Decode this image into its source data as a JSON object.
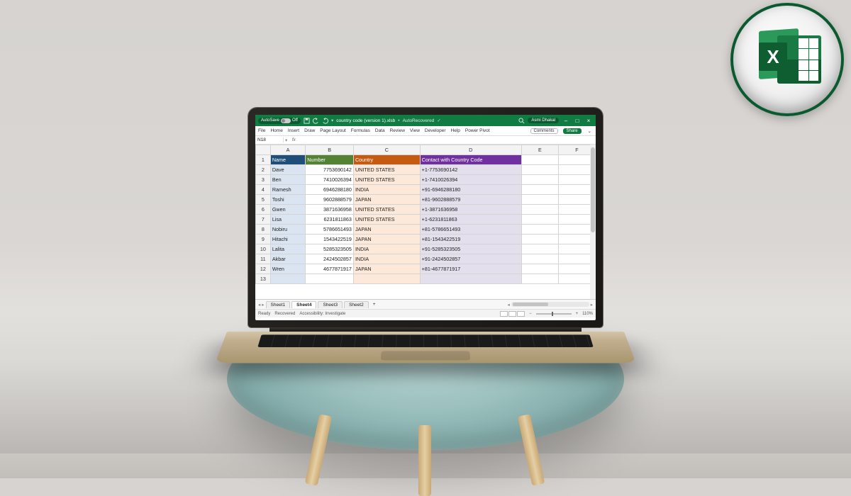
{
  "titlebar": {
    "autosave_label": "AutoSave",
    "autosave_state": "Off",
    "filename": "country code (version 1).xlsb",
    "recovered": "AutoRecovered",
    "search_placeholder": "Search",
    "user": "Asmi Dhakal",
    "minimize": "–",
    "maximize": "□",
    "close": "×"
  },
  "ribbon": {
    "tabs": [
      "File",
      "Home",
      "Insert",
      "Draw",
      "Page Layout",
      "Formulas",
      "Data",
      "Review",
      "View",
      "Developer",
      "Help",
      "Power Pivot"
    ],
    "comments": "Comments",
    "share": "Share"
  },
  "namebox": {
    "cell": "N18",
    "fx": "fx",
    "formula": ""
  },
  "columns": [
    "",
    "A",
    "B",
    "C",
    "D",
    "E",
    "F"
  ],
  "headers": {
    "a": "Name",
    "b": "Number",
    "c": "Country",
    "d": "Contact with Country Code"
  },
  "rows": [
    {
      "n": "1"
    },
    {
      "n": "2",
      "a": "Dave",
      "b": "7753690142",
      "c": "UNITED STATES",
      "d": "+1-7753690142"
    },
    {
      "n": "3",
      "a": "Ben",
      "b": "7410026394",
      "c": "UNITED STATES",
      "d": "+1-7410026394"
    },
    {
      "n": "4",
      "a": "Ramesh",
      "b": "6946288180",
      "c": "INDIA",
      "d": "+91-6946288180"
    },
    {
      "n": "5",
      "a": "Toshi",
      "b": "9602888579",
      "c": "JAPAN",
      "d": "+81-9602888579"
    },
    {
      "n": "6",
      "a": "Gwen",
      "b": "3871636958",
      "c": "UNITED STATES",
      "d": "+1-3871636958"
    },
    {
      "n": "7",
      "a": "Lisa",
      "b": "6231811863",
      "c": "UNITED STATES",
      "d": "+1-6231811863"
    },
    {
      "n": "8",
      "a": "Nobiru",
      "b": "5786651493",
      "c": "JAPAN",
      "d": "+81-5786651493"
    },
    {
      "n": "9",
      "a": "Hitachi",
      "b": "1543422519",
      "c": "JAPAN",
      "d": "+81-1543422519"
    },
    {
      "n": "10",
      "a": "Lalita",
      "b": "5285323505",
      "c": "INDIA",
      "d": "+91-5285323505"
    },
    {
      "n": "11",
      "a": "Akbar",
      "b": "2424502857",
      "c": "INDIA",
      "d": "+91-2424502857"
    },
    {
      "n": "12",
      "a": "Wren",
      "b": "4677871917",
      "c": "JAPAN",
      "d": "+81-4677871917"
    },
    {
      "n": "13",
      "a": "",
      "b": "",
      "c": "",
      "d": ""
    }
  ],
  "sheets": {
    "list": [
      "Sheet1",
      "Sheet4",
      "Sheet3",
      "Sheet2"
    ],
    "active": "Sheet4",
    "add": "+"
  },
  "status": {
    "ready": "Ready",
    "recovered": "Recovered",
    "accessibility": "Accessibility: Investigate",
    "zoom": "110%"
  },
  "badge": {
    "x": "X"
  }
}
